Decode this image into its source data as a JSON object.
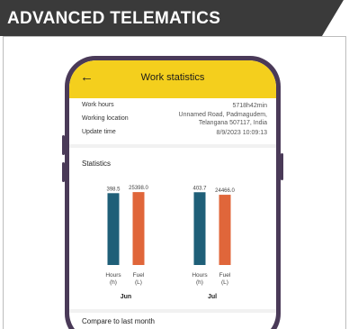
{
  "banner": {
    "title": "ADVANCED TELEMATICS"
  },
  "app": {
    "title": "Work statistics",
    "back_icon": "arrow-left-icon",
    "info": [
      {
        "label": "Work hours",
        "value": "5718h42min"
      },
      {
        "label": "Working location",
        "value_line1": "Unnamed Road, Padmagudem,",
        "value_line2": "Telangana 507117, India"
      },
      {
        "label": "Update time",
        "value": "8/9/2023 10:09:13"
      }
    ],
    "statistics_title": "Statistics",
    "compare_title": "Compare to last month"
  },
  "chart_data": {
    "type": "bar",
    "groups": [
      {
        "month": "Jun",
        "bars": [
          {
            "label_line1": "Hours",
            "label_line2": "(h)",
            "value": 398.5,
            "value_label": "398.5",
            "color": "#1f5f78"
          },
          {
            "label_line1": "Fuel",
            "label_line2": "(L)",
            "value": 25398.0,
            "value_label": "25398.0",
            "color": "#e0663a"
          }
        ]
      },
      {
        "month": "Jul",
        "bars": [
          {
            "label_line1": "Hours",
            "label_line2": "(h)",
            "value": 403.7,
            "value_label": "403.7",
            "color": "#1f5f78"
          },
          {
            "label_line1": "Fuel",
            "label_line2": "(L)",
            "value": 24466.0,
            "value_label": "24466.0",
            "color": "#e0663a"
          }
        ]
      }
    ]
  },
  "colors": {
    "banner": "#3a3a3a",
    "accent": "#f4cf1d",
    "phone": "#4a3a58"
  }
}
